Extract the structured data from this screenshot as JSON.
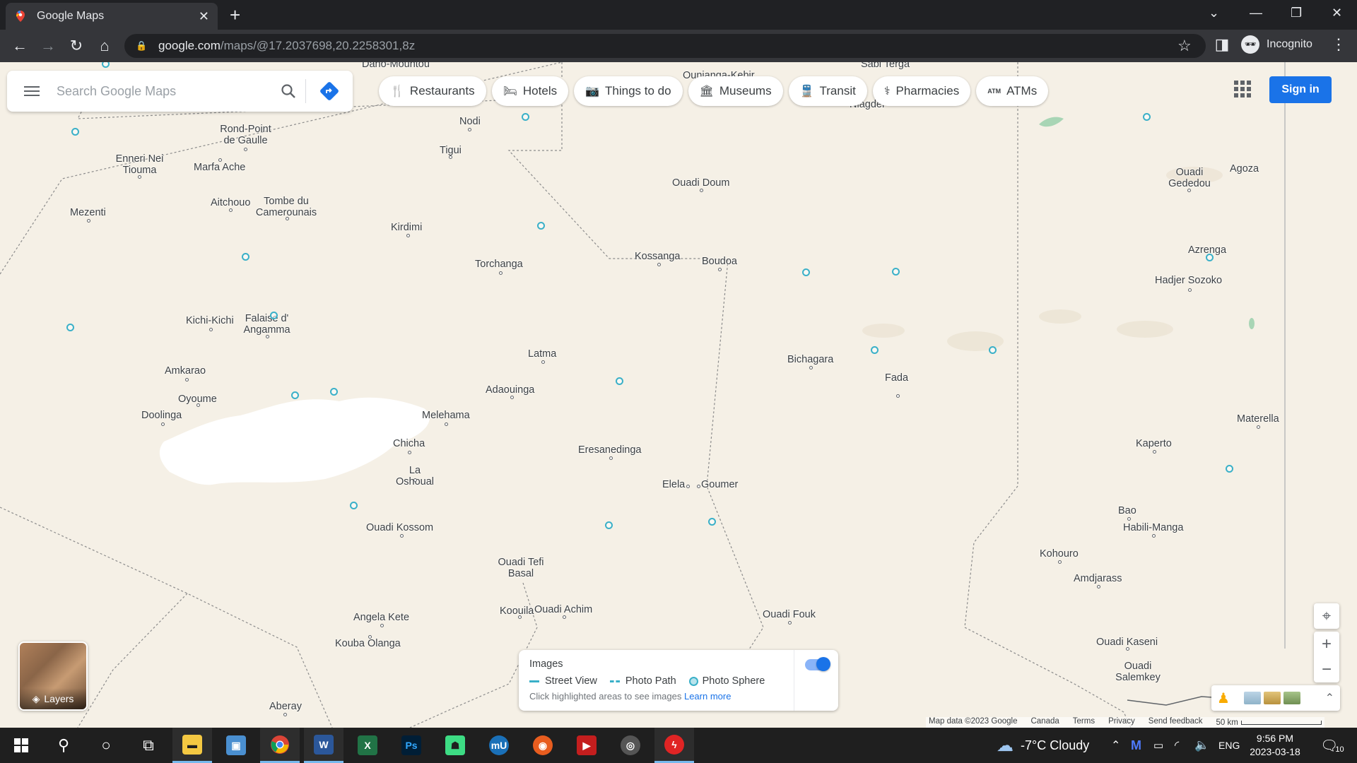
{
  "browser": {
    "tab_title": "Google Maps",
    "url_host": "google.com",
    "url_path": "/maps/@17.2037698,20.2258301,8z",
    "profile_label": "Incognito"
  },
  "search": {
    "placeholder": "Search Google Maps"
  },
  "chips": [
    {
      "label": "Restaurants",
      "icon": "fork-knife-icon"
    },
    {
      "label": "Hotels",
      "icon": "bed-icon"
    },
    {
      "label": "Things to do",
      "icon": "camera-icon"
    },
    {
      "label": "Museums",
      "icon": "museum-icon"
    },
    {
      "label": "Transit",
      "icon": "train-icon"
    },
    {
      "label": "Pharmacies",
      "icon": "pharmacy-icon"
    },
    {
      "label": "ATMs",
      "icon": "atm-icon"
    }
  ],
  "signin_label": "Sign in",
  "layers_label": "Layers",
  "images_legend": {
    "title": "Images",
    "street_view": "Street View",
    "photo_path": "Photo Path",
    "photo_sphere": "Photo Sphere",
    "hint": "Click highlighted areas to see images",
    "learn_more": "Learn more",
    "toggle_on": true
  },
  "footer": {
    "map_data": "Map data ©2023 Google",
    "country": "Canada",
    "terms": "Terms",
    "privacy": "Privacy",
    "feedback": "Send feedback",
    "scale": "50 km"
  },
  "places": [
    {
      "name": "Dano-Mountou"
    },
    {
      "name": "Ounianga-Kebir"
    },
    {
      "name": "Sabi Terga"
    },
    {
      "name": "Niagder"
    },
    {
      "name": "Nodi"
    },
    {
      "name": "Rond-Point de Gaulle"
    },
    {
      "name": "Tigui"
    },
    {
      "name": "Enneri Nei Tiouma"
    },
    {
      "name": "Marfa Ache"
    },
    {
      "name": "Ouadi Doum"
    },
    {
      "name": "Ouadi Gededou"
    },
    {
      "name": "Agoza"
    },
    {
      "name": "Aitchouo"
    },
    {
      "name": "Tombe du Camerounais"
    },
    {
      "name": "Mezenti"
    },
    {
      "name": "Kirdimi"
    },
    {
      "name": "Kossanga"
    },
    {
      "name": "Boudoa"
    },
    {
      "name": "Azrenga"
    },
    {
      "name": "Torchanga"
    },
    {
      "name": "Hadjer Sozoko"
    },
    {
      "name": "Kichi-Kichi"
    },
    {
      "name": "Falaise d' Angamma"
    },
    {
      "name": "Latma"
    },
    {
      "name": "Bichagara"
    },
    {
      "name": "Amkarao"
    },
    {
      "name": "Fada"
    },
    {
      "name": "Adaouinga"
    },
    {
      "name": "Oyoume"
    },
    {
      "name": "Doolinga"
    },
    {
      "name": "Melehama"
    },
    {
      "name": "Materella"
    },
    {
      "name": "Chicha"
    },
    {
      "name": "Kaperto"
    },
    {
      "name": "Eresanedinga"
    },
    {
      "name": "La Oshoual"
    },
    {
      "name": "Elela"
    },
    {
      "name": "Goumer"
    },
    {
      "name": "Bao"
    },
    {
      "name": "Habili-Manga"
    },
    {
      "name": "Ouadi Kossom"
    },
    {
      "name": "Kohouro"
    },
    {
      "name": "Ouadi Tefi Basal"
    },
    {
      "name": "Amdjarass"
    },
    {
      "name": "Koouila"
    },
    {
      "name": "Ouadi Achim"
    },
    {
      "name": "Ouadi Fouk"
    },
    {
      "name": "Angela Kete"
    },
    {
      "name": "Kouba Olanga"
    },
    {
      "name": "Ouadi Kaseni"
    },
    {
      "name": "Ouadi Salemkey"
    },
    {
      "name": "Aberay"
    }
  ],
  "taskbar": {
    "weather": "-7°C  Cloudy",
    "language": "ENG",
    "time": "9:56 PM",
    "date": "2023-03-18",
    "notifications": "10"
  }
}
